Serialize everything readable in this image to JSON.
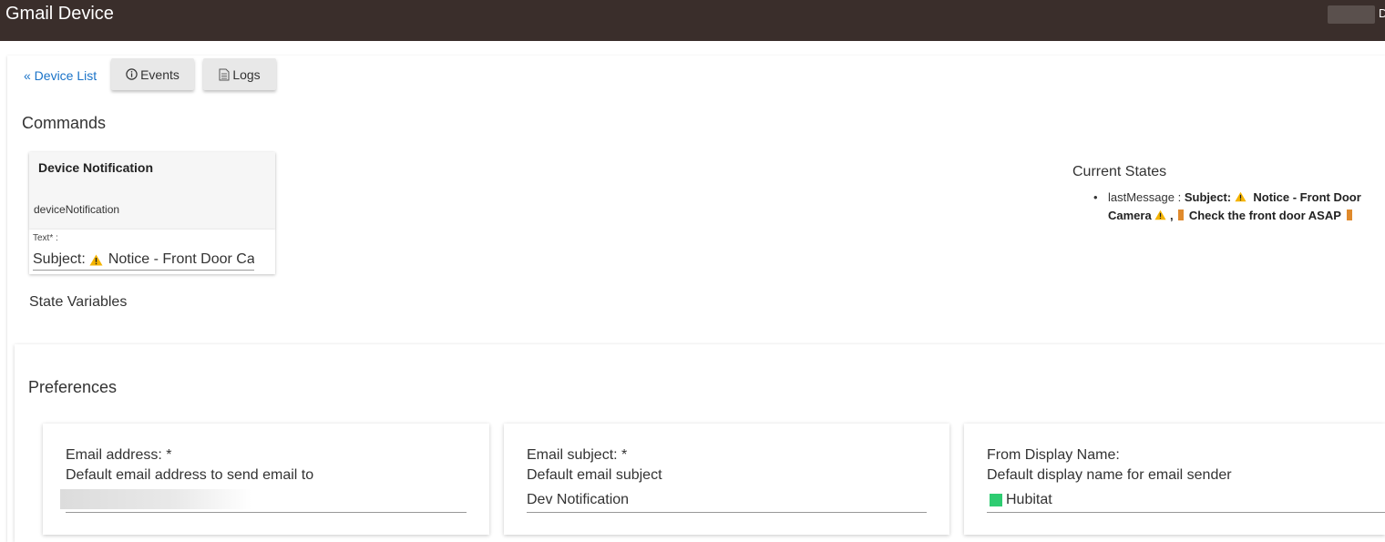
{
  "header": {
    "title": "Gmail Device",
    "user_initial": "D"
  },
  "nav": {
    "device_list": "« Device List",
    "events": "Events",
    "logs": "Logs"
  },
  "commands": {
    "title": "Commands",
    "card": {
      "title": "Device Notification",
      "method": "deviceNotification",
      "field_label": "Text* :",
      "field_value_prefix": "Subject:",
      "field_value_suffix": "Notice - Front Door Camera"
    }
  },
  "state_variables": {
    "title": "State Variables"
  },
  "current_states": {
    "title": "Current States",
    "items": [
      {
        "name": "lastMessage :",
        "value_part1": "Subject:",
        "value_part2": "Notice - Front Door Camera",
        "value_part3": ",",
        "value_part4": "Check the front door ASAP"
      }
    ]
  },
  "preferences": {
    "title": "Preferences",
    "items": [
      {
        "label": "Email address: *",
        "description": "Default email address to send email to",
        "value": ""
      },
      {
        "label": "Email subject: *",
        "description": "Default email subject",
        "value": "Dev Notification"
      },
      {
        "label": "From Display Name:",
        "description": "Default display name for email sender",
        "value": "Hubitat"
      }
    ]
  },
  "icons": {
    "events": "info-icon",
    "logs": "document-icon",
    "warning": "warning-icon",
    "door": "door-icon",
    "green_square": "green-square-icon"
  },
  "colors": {
    "header_bg": "#3a2e2b",
    "link": "#1a73c8",
    "warning": "#f5b400",
    "door": "#e08a2c",
    "green_square": "#2ecc71"
  }
}
